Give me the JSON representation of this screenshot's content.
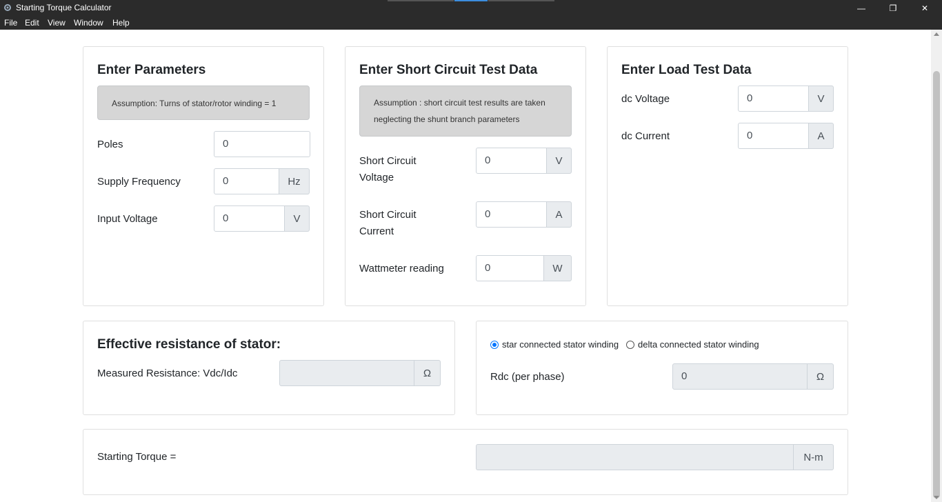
{
  "window": {
    "title": "Starting Torque Calculator",
    "controls": {
      "minimize": "—",
      "maximize": "❐",
      "close": "✕"
    }
  },
  "menu": [
    "File",
    "Edit",
    "View",
    "Window",
    "Help"
  ],
  "colors": {
    "titlebar": "#2b2b2b",
    "accent": "#0075ff",
    "card_border": "#dfdfdf",
    "addon_bg": "#e9ecef"
  },
  "parameters": {
    "title": "Enter Parameters",
    "note": "Assumption: Turns of stator/rotor winding = 1",
    "fields": [
      {
        "label": "Poles",
        "value": "0",
        "unit": ""
      },
      {
        "label": "Supply Frequency",
        "value": "0",
        "unit": "Hz"
      },
      {
        "label": "Input Voltage",
        "value": "0",
        "unit": "V"
      }
    ]
  },
  "short_circuit": {
    "title": "Enter Short Circuit Test Data",
    "note_line1": "Assumption : short circuit test results are taken",
    "note_line2": "neglecting the shunt branch parameters",
    "fields": [
      {
        "label_line1": "Short Circuit",
        "label_line2": "Voltage",
        "value": "0",
        "unit": "V"
      },
      {
        "label_line1": "Short Circuit",
        "label_line2": "Current",
        "value": "0",
        "unit": "A"
      },
      {
        "label_line1": "Wattmeter reading",
        "label_line2": "",
        "value": "0",
        "unit": "W"
      }
    ]
  },
  "load_test": {
    "title": "Enter Load Test Data",
    "fields": [
      {
        "label": "dc Voltage",
        "value": "0",
        "unit": "V"
      },
      {
        "label": "dc Current",
        "value": "0",
        "unit": "A"
      }
    ]
  },
  "stator_resistance": {
    "title": "Effective resistance of stator:",
    "label": "Measured Resistance: Vdc/Idc",
    "value": "",
    "unit": "Ω"
  },
  "winding": {
    "options": [
      {
        "label": "star connected stator winding",
        "checked": true
      },
      {
        "label": "delta connected stator winding",
        "checked": false
      }
    ],
    "rdc_label": "Rdc (per phase)",
    "rdc_value": "0",
    "rdc_unit": "Ω"
  },
  "torque": {
    "label": "Starting Torque =",
    "value": "",
    "unit": "N-m"
  }
}
